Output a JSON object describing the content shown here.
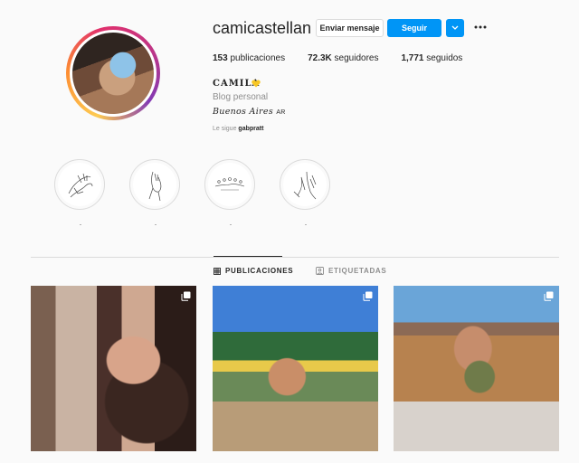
{
  "profile": {
    "username": "camicastellan",
    "full_name": "CAMILA",
    "category": "Blog personal",
    "location": "Buenos Aires",
    "location_suffix": "AR",
    "followed_by_prefix": "Le sigue",
    "followed_by_user": "gabpratt"
  },
  "actions": {
    "message_label": "Enviar mensaje",
    "follow_label": "Seguir",
    "follow_color": "#0095f6"
  },
  "stats": {
    "posts_count": "153",
    "posts_label": "publicaciones",
    "followers_count": "72.3K",
    "followers_label": "seguidores",
    "following_count": "1,771",
    "following_label": "seguidos"
  },
  "highlights": [
    {
      "label": ".",
      "icon": "hands-sketch-icon"
    },
    {
      "label": ".",
      "icon": "hand-sketch-icon"
    },
    {
      "label": ".",
      "icon": "flowers-sketch-icon"
    },
    {
      "label": ".",
      "icon": "fingers-sketch-icon"
    }
  ],
  "tabs": [
    {
      "label": "PUBLICACIONES",
      "icon": "grid-icon",
      "active": true
    },
    {
      "label": "ETIQUETADAS",
      "icon": "tag-icon",
      "active": false
    }
  ],
  "posts": [
    {
      "icon": "multiple-photos-icon"
    },
    {
      "icon": "multiple-photos-icon"
    },
    {
      "icon": "multiple-photos-icon"
    }
  ]
}
